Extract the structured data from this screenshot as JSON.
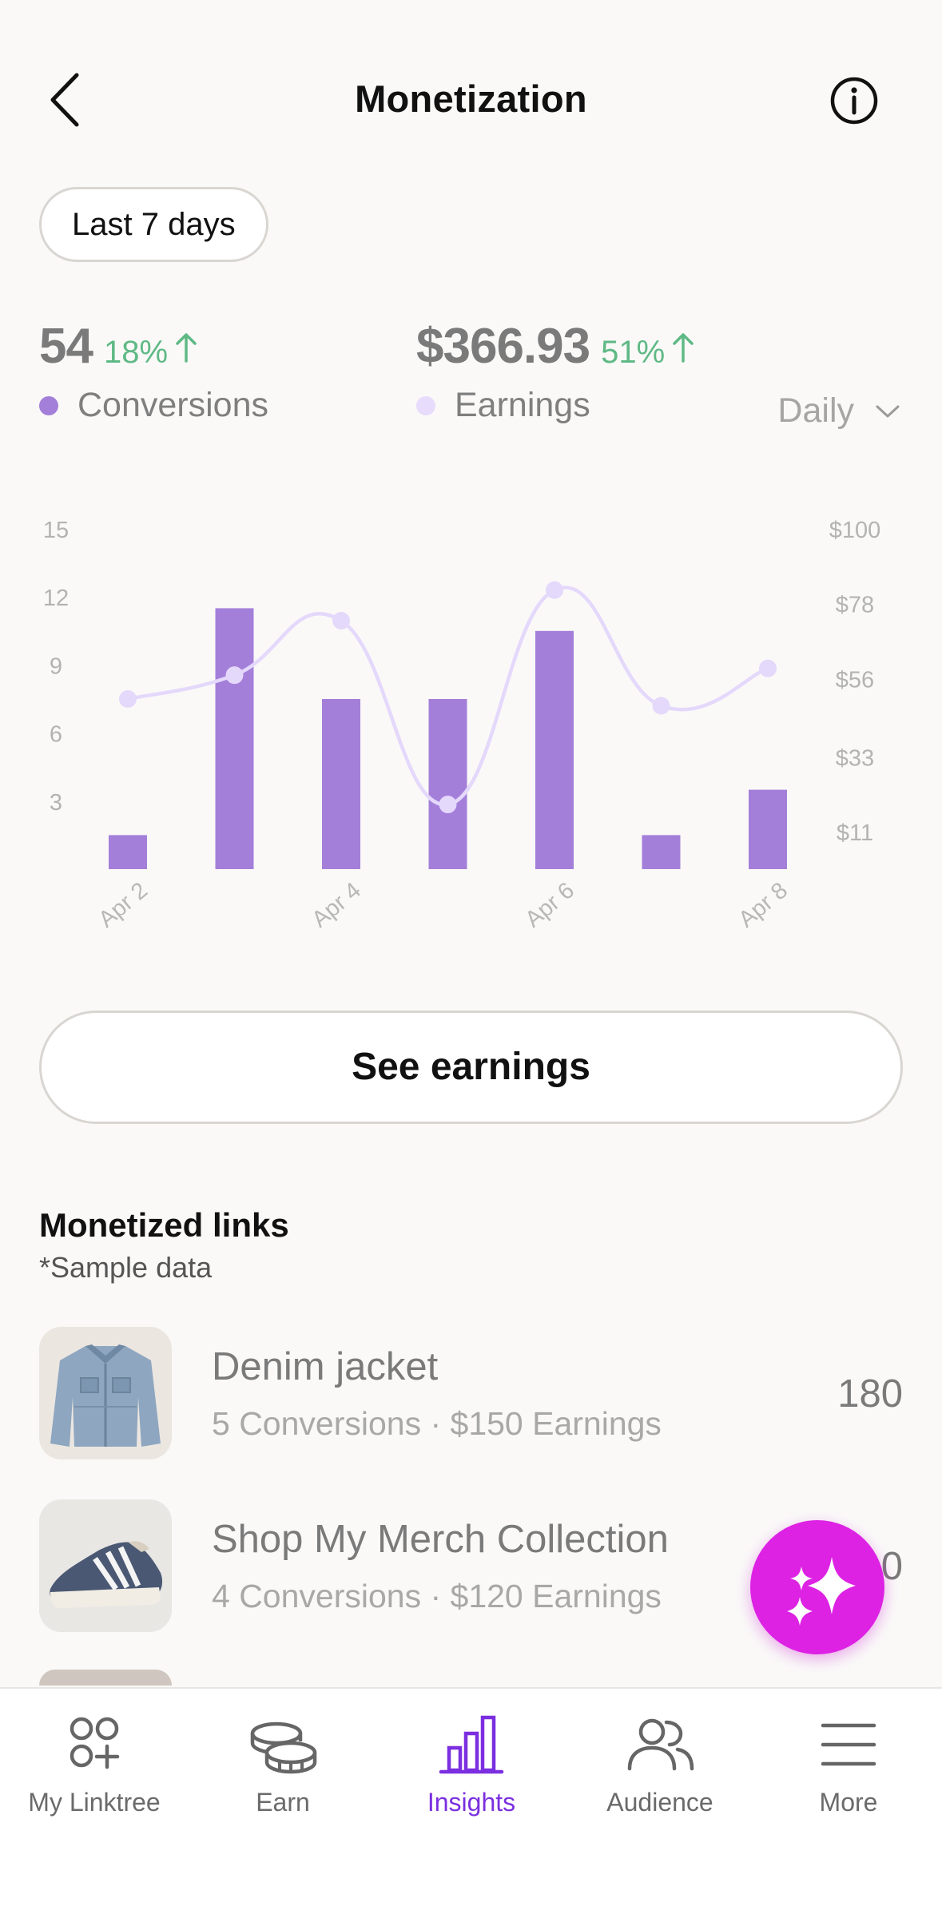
{
  "header": {
    "title": "Monetization"
  },
  "range": {
    "label": "Last 7 days"
  },
  "stats": {
    "conversions": {
      "value": "54",
      "change": "18%",
      "label": "Conversions",
      "color": "#a47fda"
    },
    "earnings": {
      "value": "$366.93",
      "change": "51%",
      "label": "Earnings",
      "color": "#e7dcfb"
    },
    "up_color": "#5fb985"
  },
  "period": {
    "selected": "Daily"
  },
  "chart_data": {
    "type": "bar",
    "categories": [
      "Apr 2",
      "Apr 3",
      "Apr 4",
      "Apr 5",
      "Apr 6",
      "Apr 7",
      "Apr 8"
    ],
    "x_tick_labels": [
      "Apr 2",
      "",
      "Apr 4",
      "",
      "Apr 6",
      "",
      "Apr 8"
    ],
    "series": [
      {
        "name": "Conversions",
        "type": "bar",
        "axis": "left",
        "color": "#a47fda",
        "values": [
          1.5,
          11.5,
          7.5,
          7.5,
          10.5,
          1.5,
          3.5
        ]
      },
      {
        "name": "Earnings",
        "type": "line",
        "axis": "right",
        "color": "#e4d8fb",
        "values": [
          50,
          57,
          73,
          19,
          82,
          48,
          59
        ]
      }
    ],
    "y_left": {
      "ticks": [
        3,
        6,
        9,
        12,
        15
      ],
      "tick_labels": [
        "3",
        "6",
        "9",
        "12",
        "15"
      ],
      "range": [
        0,
        15
      ]
    },
    "y_right": {
      "ticks": [
        11,
        33,
        56,
        78,
        100
      ],
      "tick_labels": [
        "$11",
        "$33",
        "$56",
        "$78",
        "$100"
      ],
      "range": [
        0,
        100
      ]
    },
    "grid": false
  },
  "actions": {
    "see_earnings": "See earnings"
  },
  "monetized": {
    "title": "Monetized links",
    "subtitle": "*Sample data",
    "items": [
      {
        "name": "Denim jacket",
        "conversions": "5 Conversions",
        "earnings": "$150 Earnings",
        "count": "180"
      },
      {
        "name": "Shop My Merch Collection",
        "conversions": "4 Conversions",
        "earnings": "$120 Earnings",
        "count": "0"
      }
    ]
  },
  "tabs": [
    {
      "label": "My Linktree",
      "icon": "linktree-icon"
    },
    {
      "label": "Earn",
      "icon": "coins-icon"
    },
    {
      "label": "Insights",
      "icon": "bar-chart-icon",
      "active": true
    },
    {
      "label": "Audience",
      "icon": "people-icon"
    },
    {
      "label": "More",
      "icon": "menu-icon"
    }
  ],
  "fab": {
    "icon": "sparkle-icon",
    "color": "#dd22e4"
  }
}
